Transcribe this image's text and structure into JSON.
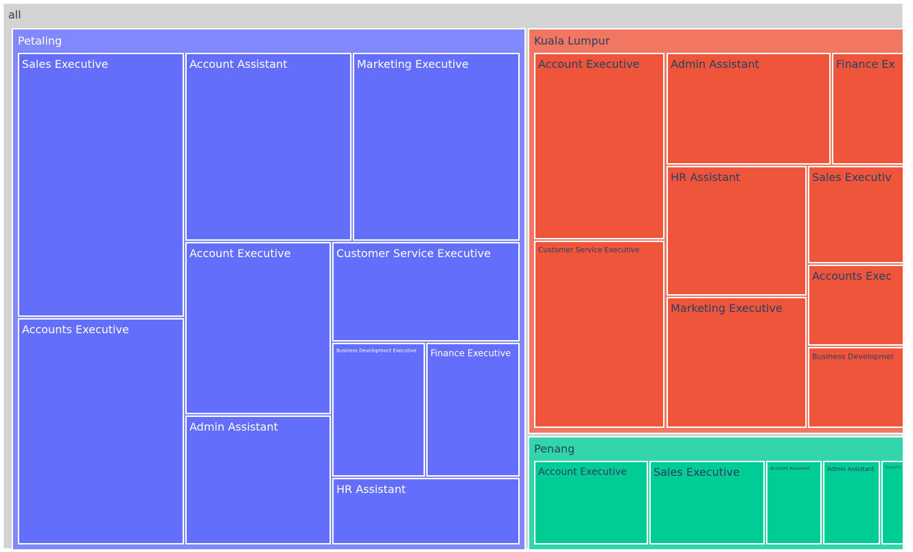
{
  "chart_data": {
    "type": "treemap",
    "root": {
      "label": "all",
      "color": "#d3d3d3",
      "text_color": "#2a3f5f"
    },
    "branches": [
      {
        "label": "Petaling",
        "color": "#636efa",
        "parent_color": "#8088fb",
        "text_color": "#ffffff",
        "children": [
          {
            "label": "Sales Executive"
          },
          {
            "label": "Accounts Executive"
          },
          {
            "label": "Account Assistant"
          },
          {
            "label": "Marketing Executive"
          },
          {
            "label": "Account Executive"
          },
          {
            "label": "Admin Assistant"
          },
          {
            "label": "Customer Service Executive"
          },
          {
            "label": "Business Development Executive"
          },
          {
            "label": "Finance Executive"
          },
          {
            "label": "HR Assistant"
          }
        ]
      },
      {
        "label": "Kuala Lumpur",
        "color": "#ef553b",
        "parent_color": "#f17762",
        "text_color": "#2a3f5f",
        "children": [
          {
            "label": "Account Executive"
          },
          {
            "label": "Customer Service Executive"
          },
          {
            "label": "Admin Assistant"
          },
          {
            "label": "Finance Ex"
          },
          {
            "label": "HR Assistant"
          },
          {
            "label": "Marketing Executive"
          },
          {
            "label": "Sales Executiv"
          },
          {
            "label": "Accounts Exec"
          },
          {
            "label": "Business Developmer"
          }
        ]
      },
      {
        "label": "Penang",
        "color": "#00cc96",
        "parent_color": "#33d6ab",
        "text_color": "#2a3f5f",
        "children": [
          {
            "label": "Account Executive"
          },
          {
            "label": "Sales Executive"
          },
          {
            "label": "Account Assistant"
          },
          {
            "label": "Admin Assistant"
          },
          {
            "label": "Business D"
          }
        ]
      }
    ]
  }
}
